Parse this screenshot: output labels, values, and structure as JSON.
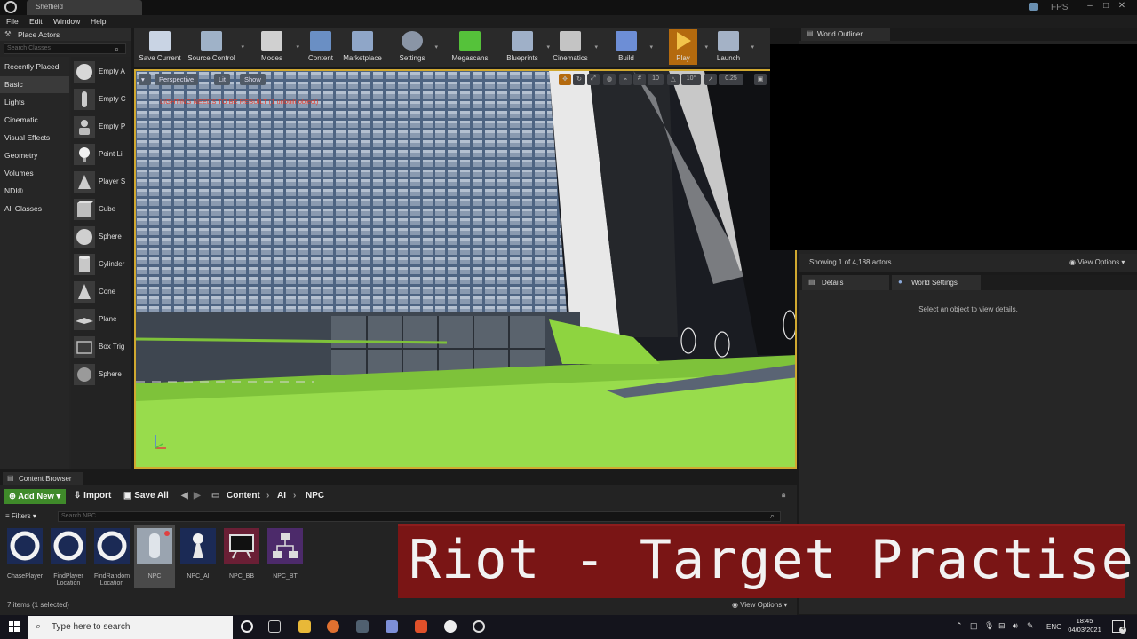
{
  "window": {
    "tab_title": "Sheffield",
    "fps_label": "FPS"
  },
  "menu": [
    "File",
    "Edit",
    "Window",
    "Help"
  ],
  "place_actors": {
    "title": "Place Actors",
    "search_placeholder": "Search Classes",
    "categories": [
      "Recently Placed",
      "Basic",
      "Lights",
      "Cinematic",
      "Visual Effects",
      "Geometry",
      "Volumes",
      "NDI®",
      "All Classes"
    ],
    "active_category": "Basic",
    "actors": [
      "Empty A",
      "Empty C",
      "Empty P",
      "Point Li",
      "Player S",
      "Cube",
      "Sphere",
      "Cylinder",
      "Cone",
      "Plane",
      "Box Trig",
      "Sphere"
    ]
  },
  "toolbar": [
    "Save Current",
    "Source Control",
    "Modes",
    "Content",
    "Marketplace",
    "Settings",
    "Megascans",
    "Blueprints",
    "Cinematics",
    "Build",
    "Play",
    "Launch"
  ],
  "viewport": {
    "perspective": "Perspective",
    "lit": "Lit",
    "show": "Show",
    "warning": "LIGHTING NEEDS TO BE REBUILT (1 unbuilt object)",
    "grid_snap": "10",
    "rot_snap": "10°",
    "scale_snap": "0.25"
  },
  "world_outliner": {
    "title": "World Outliner",
    "status": "Showing 1 of 4,188 actors",
    "view_options": "View Options"
  },
  "details": {
    "tab_details": "Details",
    "tab_world_settings": "World Settings",
    "empty_text": "Select an object to view details."
  },
  "content_browser": {
    "title": "Content Browser",
    "add_new": "Add New",
    "import": "Import",
    "save_all": "Save All",
    "path": [
      "Content",
      "AI",
      "NPC"
    ],
    "filters": "Filters",
    "search_placeholder": "Search NPC",
    "assets": [
      {
        "name": "ChasePlayer",
        "kind": "task"
      },
      {
        "name": "FindPlayer Location",
        "kind": "task"
      },
      {
        "name": "FindRandom Location",
        "kind": "task"
      },
      {
        "name": "NPC",
        "kind": "blueprint"
      },
      {
        "name": "NPC_AI",
        "kind": "controller"
      },
      {
        "name": "NPC_BB",
        "kind": "blackboard"
      },
      {
        "name": "NPC_BT",
        "kind": "behavior-tree"
      }
    ],
    "selected": "NPC",
    "items_count": "7 items (1 selected)",
    "view_options": "View Options"
  },
  "overlay_title": "Riot - Target Practise",
  "taskbar": {
    "search_placeholder": "Type here to search",
    "lang": "ENG",
    "time": "18:45",
    "date": "04/03/2021",
    "notification_count": "4"
  },
  "colors": {
    "accent_play": "#b46a0e",
    "add_new": "#3f8a2a",
    "banner": "#7a1515",
    "viewport_border": "#d0a830"
  }
}
